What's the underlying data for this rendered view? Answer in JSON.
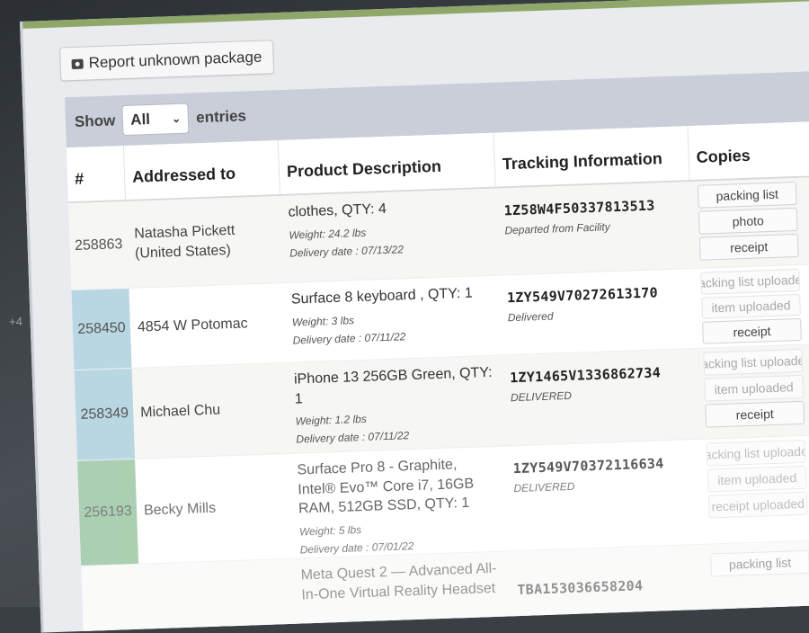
{
  "page": {
    "side_label": "+4"
  },
  "toolbar": {
    "report_label": "Report unknown package",
    "report_icon": "camera-icon"
  },
  "table_controls": {
    "show_label": "Show",
    "page_size": "All",
    "entries_label": "entries"
  },
  "columns": [
    "#",
    "Addressed to",
    "Product Description",
    "Tracking Information",
    "Copies"
  ],
  "rows": [
    {
      "id": "258863",
      "addressed_to": "Natasha Pickett (United States)",
      "product": "clothes, QTY: 4",
      "weight": "Weight: 24.2 lbs",
      "delivery_date": "Delivery date : 07/13/22",
      "tracking_number": "1Z58W4F50337813513",
      "tracking_status": "Departed from Facility",
      "copies": [
        "packing list",
        "photo",
        "receipt"
      ]
    },
    {
      "id": "258450",
      "addressed_to": "4854 W Potomac",
      "product": "Surface 8 keyboard , QTY: 1",
      "weight": "Weight: 3 lbs",
      "delivery_date": "Delivery date : 07/11/22",
      "tracking_number": "1ZY549V70272613170",
      "tracking_status": "Delivered",
      "copies": [
        "packing list uploaded",
        "item uploaded",
        "receipt"
      ]
    },
    {
      "id": "258349",
      "addressed_to": "Michael Chu",
      "product": "iPhone 13 256GB Green, QTY: 1",
      "weight": "Weight: 1.2 lbs",
      "delivery_date": "Delivery date : 07/11/22",
      "tracking_number": "1ZY1465V1336862734",
      "tracking_status": "DELIVERED",
      "copies": [
        "packing list uploaded",
        "item uploaded",
        "receipt"
      ]
    },
    {
      "id": "256193",
      "addressed_to": "Becky Mills",
      "product": "Surface Pro 8 - Graphite, Intel® Evo™ Core i7, 16GB RAM, 512GB SSD, QTY: 1",
      "weight": "Weight: 5 lbs",
      "delivery_date": "Delivery date : 07/01/22",
      "tracking_number": "1ZY549V70372116634",
      "tracking_status": "DELIVERED",
      "copies": [
        "packing list uploaded",
        "item uploaded",
        "receipt uploaded"
      ]
    },
    {
      "id": "",
      "addressed_to": "",
      "product": "Meta Quest 2 — Advanced All-In-One Virtual Reality Headset",
      "weight": "",
      "delivery_date": "",
      "tracking_number": "TBA153036658204",
      "tracking_status": "",
      "copies": [
        "packing list"
      ]
    }
  ]
}
